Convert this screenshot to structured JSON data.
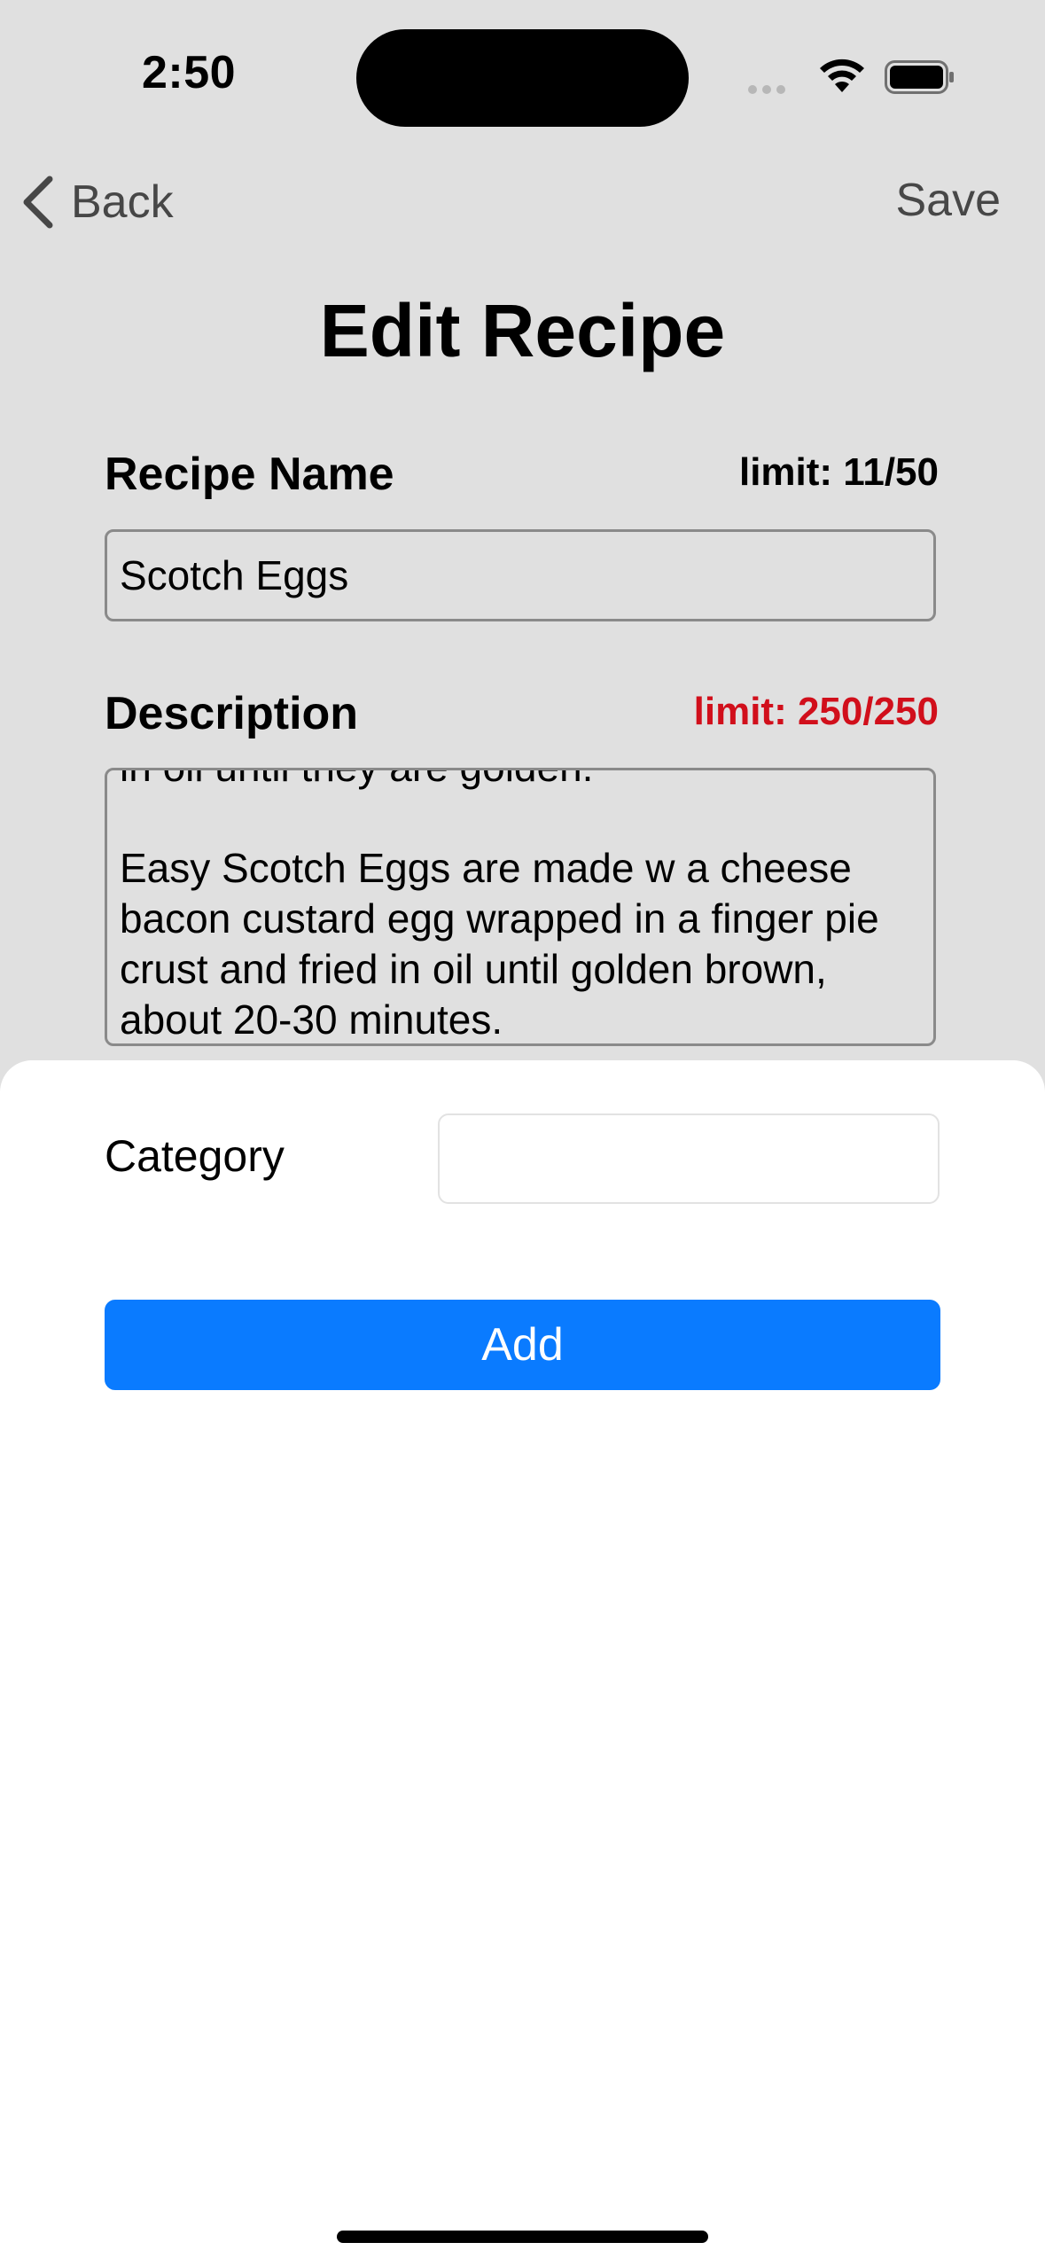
{
  "status_bar": {
    "time": "2:50"
  },
  "nav": {
    "back_label": "Back",
    "save_label": "Save"
  },
  "page": {
    "title": "Edit Recipe"
  },
  "recipe_name": {
    "label": "Recipe Name",
    "limit": "limit: 11/50",
    "value": "Scotch Eggs"
  },
  "description": {
    "label": "Description",
    "limit": "limit: 250/250",
    "limit_color": "#d10f1b",
    "value_visible": "in oil until they are golden.\n\nEasy Scotch Eggs are made w a cheese bacon custard egg wrapped in a finger pie crust and fried in oil until golden brown, about 20-30 minutes."
  },
  "sheet": {
    "category_label": "Category",
    "category_value": "",
    "add_label": "Add",
    "add_color": "#0a7bff"
  },
  "icons": [
    "chevron-left-icon",
    "cellular-signal-icon",
    "wifi-icon",
    "battery-icon"
  ]
}
